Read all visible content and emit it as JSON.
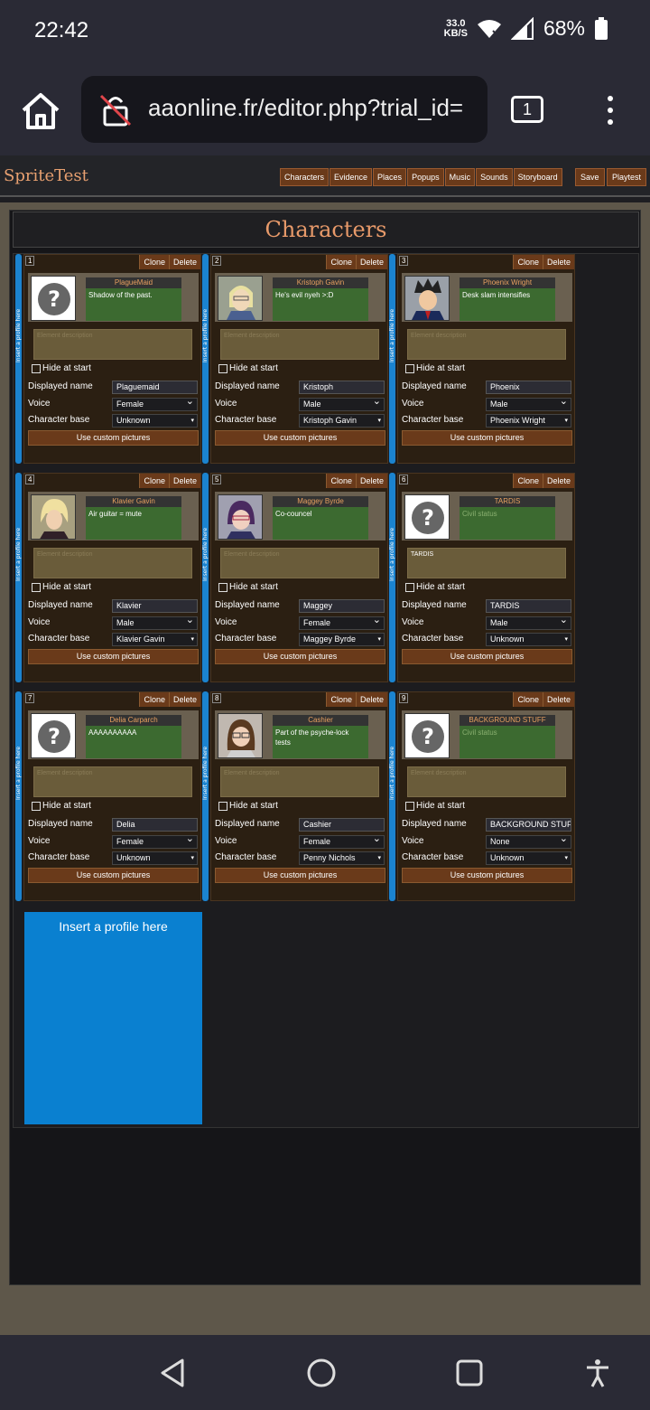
{
  "status": {
    "time": "22:42",
    "net_speed_value": "33.0",
    "net_speed_unit": "KB/S",
    "battery": "68%"
  },
  "browser": {
    "url": "aaonline.fr/editor.php?trial_id=",
    "tab_count": "1"
  },
  "app": {
    "title": "SpriteTest",
    "nav": [
      "Characters",
      "Evidence",
      "Places",
      "Popups",
      "Music",
      "Sounds",
      "Storyboard"
    ],
    "save": "Save",
    "playtest": "Playtest",
    "section_title": "Characters"
  },
  "labels": {
    "clone": "Clone",
    "delete": "Delete",
    "hide_at_start": "Hide at start",
    "displayed_name": "Displayed name",
    "voice": "Voice",
    "character_base": "Character base",
    "use_custom_pictures": "Use custom pictures",
    "desc_placeholder": "Element description",
    "status_placeholder": "Civil status",
    "insert_profile": "Insert a profile here"
  },
  "characters": [
    {
      "num": "1",
      "name": "PlagueMaid",
      "status": "Shadow of the past.",
      "description": "",
      "displayed_name": "Plaguemaid",
      "voice": "Female",
      "base": "Unknown",
      "avatar": "unknown"
    },
    {
      "num": "2",
      "name": "Kristoph Gavin",
      "status": "He's evil nyeh >:D",
      "description": "",
      "displayed_name": "Kristoph",
      "voice": "Male",
      "base": "Kristoph Gavin",
      "avatar": "kristoph"
    },
    {
      "num": "3",
      "name": "Phoenix Wright",
      "status": "Desk slam intensifies",
      "description": "",
      "displayed_name": "Phoenix",
      "voice": "Male",
      "base": "Phoenix Wright",
      "avatar": "phoenix"
    },
    {
      "num": "4",
      "name": "Klavier Gavin",
      "status": "Air guitar = mute",
      "description": "",
      "displayed_name": "Klavier",
      "voice": "Male",
      "base": "Klavier Gavin",
      "avatar": "klavier"
    },
    {
      "num": "5",
      "name": "Maggey Byrde",
      "status": "Co-councel",
      "description": "",
      "displayed_name": "Maggey",
      "voice": "Female",
      "base": "Maggey Byrde",
      "avatar": "maggey"
    },
    {
      "num": "6",
      "name": "TARDIS",
      "status": "",
      "description": "TARDIS",
      "displayed_name": "TARDIS",
      "voice": "Male",
      "base": "Unknown",
      "avatar": "unknown"
    },
    {
      "num": "7",
      "name": "Delia Carparch",
      "status": "AAAAAAAAAA",
      "description": "",
      "displayed_name": "Delia",
      "voice": "Female",
      "base": "Unknown",
      "avatar": "unknown"
    },
    {
      "num": "8",
      "name": "Cashier",
      "status": "Part of the psyche-lock tests",
      "description": "",
      "displayed_name": "Cashier",
      "voice": "Female",
      "base": "Penny Nichols",
      "avatar": "cashier"
    },
    {
      "num": "9",
      "name": "BACKGROUND STUFF",
      "status": "",
      "description": "",
      "displayed_name": "BACKGROUND STUFF",
      "voice": "None",
      "base": "Unknown",
      "avatar": "unknown"
    }
  ],
  "colors": {
    "accent": "#e89a6a",
    "button": "#6a3a1a",
    "status_green": "#3c6a30",
    "insert_blue": "#0a80d0"
  }
}
